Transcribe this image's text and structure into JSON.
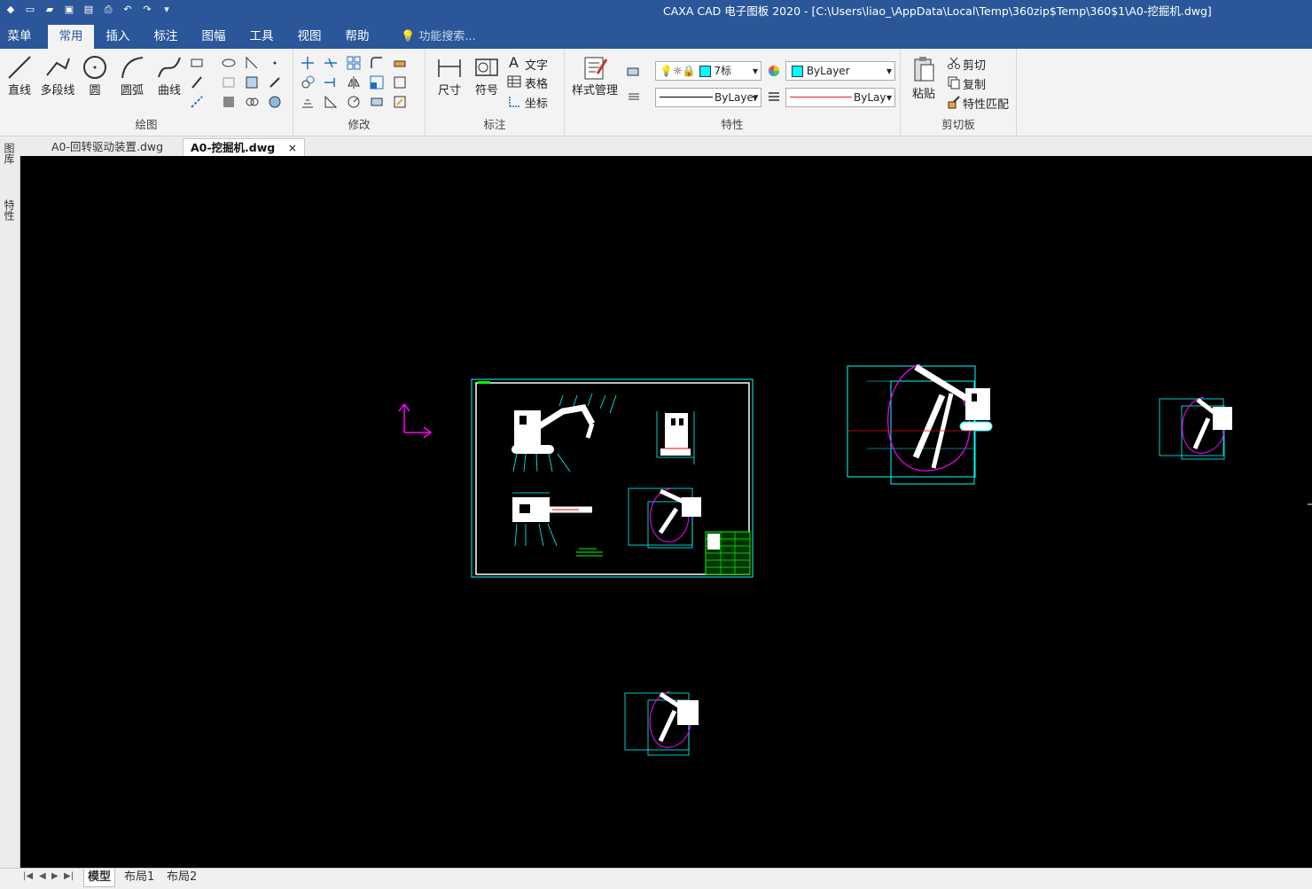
{
  "window": {
    "title": "CAXA CAD 电子图板 2020 - [C:\\Users\\liao_\\AppData\\Local\\Temp\\360zip$Temp\\360$1\\A0-挖掘机.dwg]"
  },
  "menu": {
    "items": [
      "菜单",
      "常用",
      "插入",
      "标注",
      "图幅",
      "工具",
      "视图",
      "帮助"
    ],
    "active": "常用",
    "search_placeholder": "功能搜索..."
  },
  "ribbon": {
    "draw": {
      "label": "绘图",
      "line": "直线",
      "polyline": "多段线",
      "circle": "圆",
      "arc": "圆弧",
      "curve": "曲线"
    },
    "modify": {
      "label": "修改"
    },
    "annotate": {
      "label": "标注",
      "dimension": "尺寸",
      "symbol": "符号",
      "text": "文字",
      "table": "表格",
      "coord": "坐标"
    },
    "properties": {
      "label": "特性",
      "style_manager": "样式管理",
      "layer_value": "7标",
      "color_value": "ByLayer",
      "linetype_value": "ByLayer",
      "lineweight_value": "ByLay"
    },
    "clipboard": {
      "label": "剪切板",
      "paste": "粘贴",
      "cut": "剪切",
      "copy": "复制",
      "match": "特性匹配"
    }
  },
  "doc_tabs": [
    {
      "label": "A0-回转驱动装置.dwg"
    },
    {
      "label": "A0-挖掘机.dwg",
      "close": "×"
    }
  ],
  "left_panel": {
    "tab1": "图库",
    "tab2": "特性"
  },
  "layout_tabs": [
    "模型",
    "布局1",
    "布局2"
  ],
  "colors": {
    "accent": "#2b579a",
    "canvas": "#000000",
    "cyan": "#00ffff",
    "magenta": "#ff00ff",
    "green": "#00ff00"
  }
}
